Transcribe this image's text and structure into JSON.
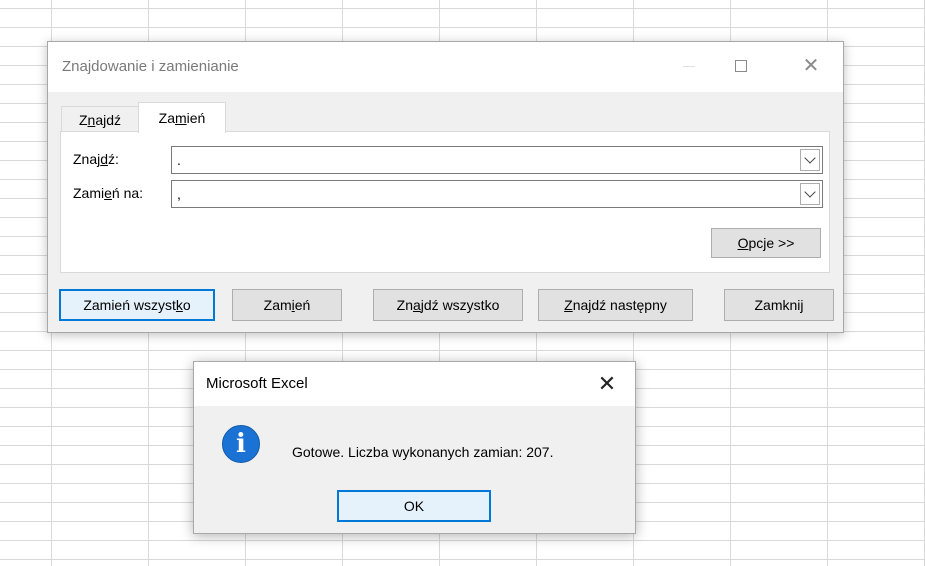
{
  "find_replace": {
    "title": "Znajdowanie i zamienianie",
    "tabs": [
      {
        "pre": "Z",
        "u": "n",
        "post": "ajdź"
      },
      {
        "pre": "Za",
        "u": "m",
        "post": "ień"
      }
    ],
    "find_label": {
      "pre": "Znaj",
      "u": "d",
      "post": "ź:"
    },
    "find_value": ".",
    "replace_label": {
      "pre": "Zami",
      "u": "e",
      "post": "ń na:"
    },
    "replace_value": ",",
    "options_button": {
      "pre": "",
      "u": "O",
      "post": "pcje >>"
    },
    "buttons": {
      "replace_all": {
        "pre": "Zamień wszyst",
        "u": "k",
        "post": "o"
      },
      "replace": {
        "pre": "Zam",
        "u": "i",
        "post": "eń"
      },
      "find_all": {
        "pre": "Zn",
        "u": "a",
        "post": "jdź wszystko"
      },
      "find_next": {
        "pre": "",
        "u": "Z",
        "post": "najdź następny"
      },
      "close": "Zamknij"
    }
  },
  "message_box": {
    "title": "Microsoft Excel",
    "close_glyph": "✕",
    "icon_glyph": "i",
    "message": "Gotowe. Liczba wykonanych zamian: 207.",
    "ok_label": "OK"
  }
}
